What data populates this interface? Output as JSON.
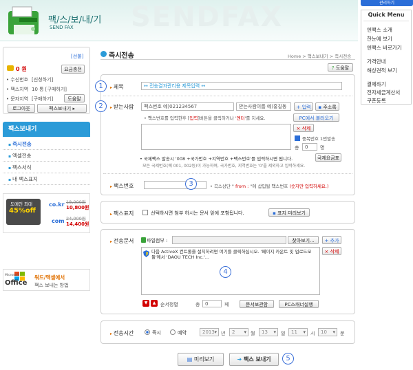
{
  "header": {
    "logo_title": "팩/스/보/내/기",
    "logo_sub": "SEND FAX",
    "watermark": "SENDFAX"
  },
  "login_box": {
    "signup_link": "[선불]",
    "points": "0 원",
    "charge_button": "요금충전",
    "rows": [
      {
        "label": "• 수신번호",
        "value": "[신청하기]"
      },
      {
        "label": "• 팩스지역",
        "value": "10 통  [구매하기]"
      },
      {
        "label": "• 문자지역",
        "value": "[구매하기]"
      }
    ],
    "help_button": "도움말",
    "logout_button": "로그아웃",
    "sendfax_button": "팩스보내기 ▸"
  },
  "left_nav": {
    "section_title": "팩스보내기",
    "items": [
      "즉시전송",
      "엑셀전송",
      "팩스서식",
      "내 팩스표지"
    ]
  },
  "ads": {
    "promo_title": "도메인 최대",
    "promo_pct": "45%off",
    "domains": [
      {
        "tld": "co.kr",
        "old": "18,000원",
        "new": "10,800원"
      },
      {
        "tld": "com",
        "old": "24,000원",
        "new": "14,400원"
      }
    ],
    "office_brand": "Microsoft",
    "office_name": "Office",
    "office_line1": "워드/엑셀에서",
    "office_line2": "팩스 보내는 방법"
  },
  "page": {
    "title": "즉시전송",
    "breadcrumb": "Home  >  팩스보내기  >  즉시전송",
    "help_button": "도움말"
  },
  "form": {
    "subject_label": "제목",
    "subject_placeholder": "↔ 전송결과관리용 제목입력 ↔",
    "recipient_label": "받는사람",
    "fax_number_value": "팩스번호 예)021234567",
    "recipient_name_value": "받는사람이름 예)홍길동",
    "add_button": "+ 입력",
    "address_button": "주소록",
    "recipient_hint_a": "• 팩스번호를 입력한후 [",
    "recipient_hint_b": "입력",
    "recipient_hint_c": "]버튼을 클릭하거나 '",
    "recipient_hint_d": "엔터",
    "recipient_hint_e": "'를 치세요.",
    "pc_load_button": "PC에서 불러오기",
    "delete_button": "× 삭제",
    "dup_check": "중복번호 1번발송",
    "total_label": "총",
    "total_value": "0",
    "total_unit": "명",
    "intl_note1": "• 국제팩스 발송시 '008 +국가번호 +지역번호 +팩스번호'를 입력하시면 됩니다.",
    "intl_note2": "모든 국제번호(예 001, 002등)이 가능하며, 국가번호, 지역번호는 '0'을 제외하고 입력하세요.",
    "intl_rate_button": "국제요금표",
    "faxno_label": "팩스번호",
    "sender_hint_a": "• 곡스상단 \" ",
    "sender_hint_b": "from :",
    "sender_hint_c": " \"에 삽입될 팩스번호 ",
    "sender_hint_d": "(숫자만 입력하세요.)",
    "cover_label": "팩스표지",
    "cover_check": "선택하시면 첨부 하시는 문서 앞에 포함됩니다.",
    "cover_preview_button": "표지 미리보기",
    "doc_label": "전송문서",
    "attach_label": "파일첨부 :",
    "browse_button": "찾아보기...",
    "attach_add_button": "+ 추가",
    "attach_delete_button": "× 삭제",
    "activex_msg": "다음 ActiveX 컨트롤을 설치하려면 여기를 클릭하십시오. '페이지 카운트 및 업로드모듈'에서 'DAOU TECH Inc.'...",
    "order_label": "순서정렬",
    "page_total_label": "총",
    "page_total_value": "0",
    "page_unit": "페",
    "doc_convert_button": "문서보관함",
    "pc_scan_button": "PC스캐너실행",
    "time_label": "전송시간",
    "radio_now": "즉시",
    "radio_reserve": "예약",
    "year": "2013",
    "year_unit": "년",
    "month": "2",
    "month_unit": "월",
    "day": "13",
    "day_unit": "일",
    "hour": "11",
    "hour_unit": "시",
    "minute": "10",
    "minute_unit": "분"
  },
  "footer": {
    "preview_button": "미리보기",
    "send_button": "팩스 보내기"
  },
  "annotations": [
    "1",
    "2",
    "3",
    "4",
    "5"
  ],
  "right_panel": {
    "top_button": "관리하기",
    "title": "Quick Menu",
    "items": [
      "엔팩스 소개",
      "한눈에 보기",
      "엔팩스 바로가기",
      "가격안내",
      "해상견적 보기",
      "결제하기",
      "전자세금계산서",
      "쿠폰등록"
    ]
  },
  "colors": {
    "accent": "#2b9bd8",
    "orange": "#e07000",
    "red": "#d20000",
    "annotation": "#3a6fd8"
  }
}
